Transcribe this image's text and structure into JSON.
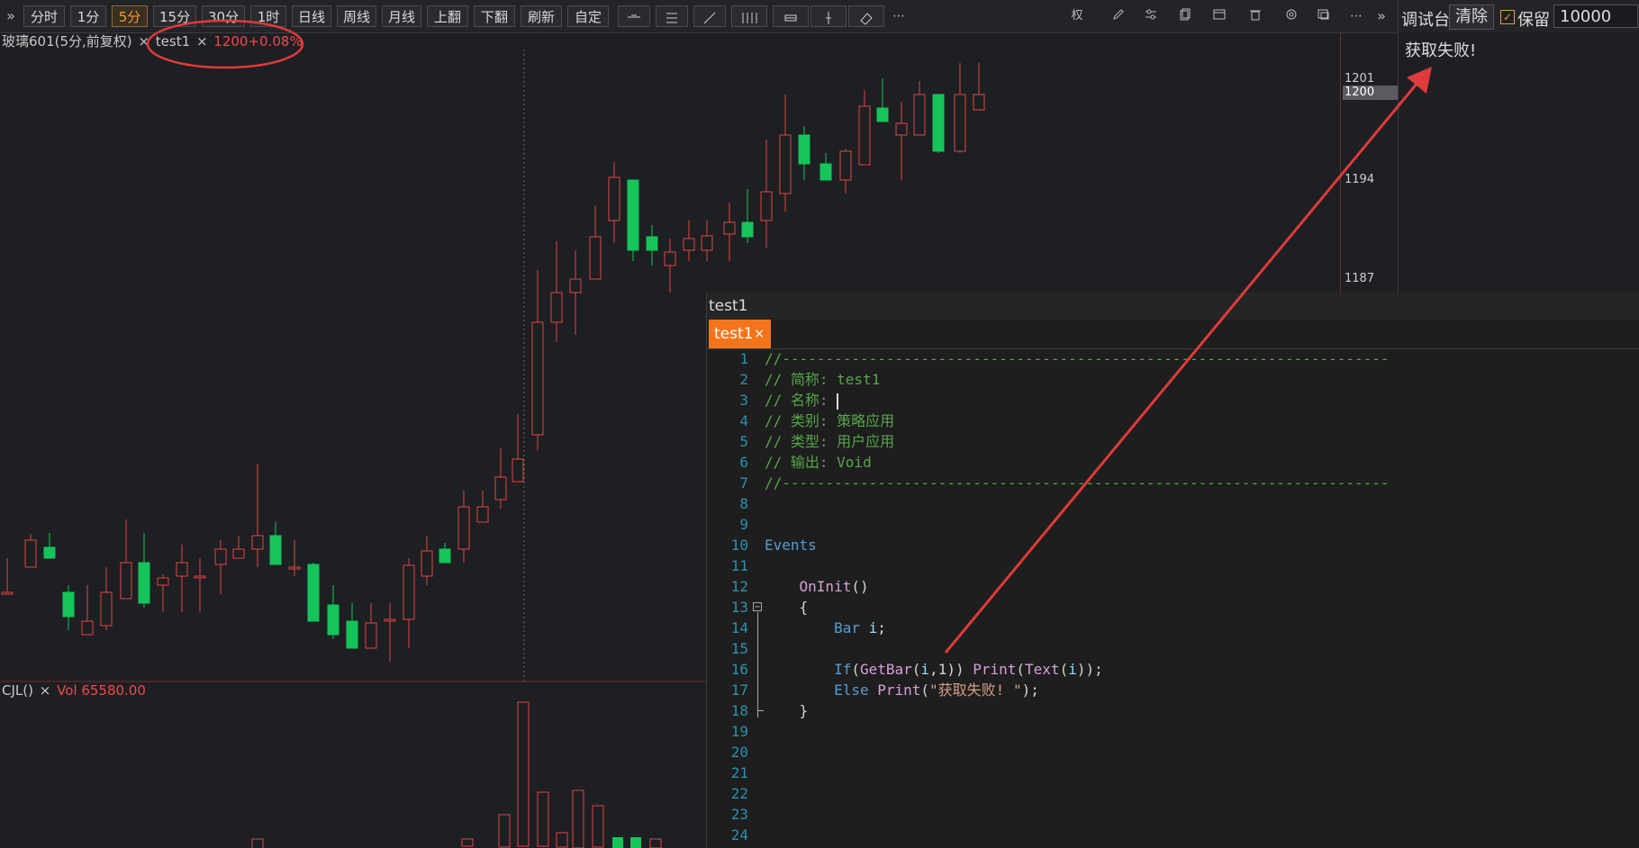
{
  "toolbar": {
    "expand_left": "»",
    "periods": [
      "分时",
      "1分",
      "5分",
      "15分",
      "30分",
      "1时",
      "日线",
      "周线",
      "月线"
    ],
    "active_period": "5分",
    "actions": [
      "上翻",
      "下翻",
      "刷新",
      "自定"
    ],
    "more": "⋯",
    "right_power": "权",
    "right_more": "⋯",
    "expand_right": "»"
  },
  "chart": {
    "symbol_label": "玻璃601(5分,前复权)",
    "indicator_name": "test1",
    "indicator_value": "1200+0.08%",
    "volume_name": "CJL()",
    "volume_value": "Vol 65580.00",
    "axis_labels": [
      "1201",
      "1194",
      "1187"
    ],
    "current_price": "1200",
    "colors": {
      "up": "#e04545",
      "down": "#16c45a",
      "annotation": "#e03a3a"
    }
  },
  "console": {
    "title": "调试台",
    "clear_label": "清除",
    "keep_label": "保留",
    "keep_checked": "✓",
    "limit_value": "10000",
    "output": "获取失败!"
  },
  "editor": {
    "window_title": "test1",
    "tab_label": "test1",
    "tab_close": "×",
    "lines": [
      {
        "n": "1",
        "t": "//----------------------------------------------------------------------"
      },
      {
        "n": "2",
        "t": "// 简称: test1"
      },
      {
        "n": "3",
        "t": "// 名称: "
      },
      {
        "n": "4",
        "t": "// 类别: 策略应用"
      },
      {
        "n": "5",
        "t": "// 类型: 用户应用"
      },
      {
        "n": "6",
        "t": "// 输出: Void"
      },
      {
        "n": "7",
        "t": "//----------------------------------------------------------------------"
      },
      {
        "n": "8",
        "t": ""
      },
      {
        "n": "9",
        "t": ""
      },
      {
        "n": "10",
        "t": "Events"
      },
      {
        "n": "11",
        "t": ""
      },
      {
        "n": "12",
        "t": "    OnInit()"
      },
      {
        "n": "13",
        "t": "    {"
      },
      {
        "n": "14",
        "t": "        Bar i;"
      },
      {
        "n": "15",
        "t": ""
      },
      {
        "n": "16",
        "t": "        If(GetBar(i,1)) Print(Text(i));"
      },
      {
        "n": "17",
        "t": "        Else Print(\"获取失败! \");"
      },
      {
        "n": "18",
        "t": "    }"
      },
      {
        "n": "19",
        "t": ""
      },
      {
        "n": "20",
        "t": ""
      },
      {
        "n": "21",
        "t": ""
      },
      {
        "n": "22",
        "t": ""
      },
      {
        "n": "23",
        "t": ""
      },
      {
        "n": "24",
        "t": ""
      }
    ]
  }
}
